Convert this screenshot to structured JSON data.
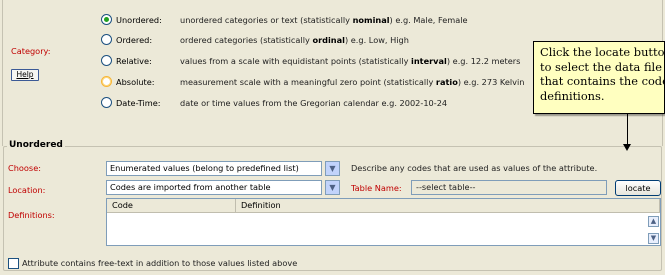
{
  "category": {
    "label": "Category:",
    "help_label": "Help",
    "options": [
      {
        "label": "Unordered:",
        "desc_pre": "unordered categories or text (statistically ",
        "desc_bold": "nominal",
        "desc_post": ") e.g. Male, Female",
        "selected": true
      },
      {
        "label": "Ordered:",
        "desc_pre": "ordered categories (statistically ",
        "desc_bold": "ordinal",
        "desc_post": ") e.g. Low, High",
        "selected": false
      },
      {
        "label": "Relative:",
        "desc_pre": "values from a scale with equidistant points (statistically ",
        "desc_bold": "interval",
        "desc_post": ") e.g. 12.2 meters",
        "selected": false
      },
      {
        "label": "Absolute:",
        "desc_pre": "measurement scale with a meaningful zero point (statistically ",
        "desc_bold": "ratio",
        "desc_post": ") e.g. 273 Kelvin",
        "selected": false
      },
      {
        "label": "Date-Time:",
        "desc_pre": "date or time values from the Gregorian calendar e.g. 2002-10-24",
        "desc_bold": "",
        "desc_post": "",
        "selected": false
      }
    ]
  },
  "unordered": {
    "group_title": "Unordered",
    "choose_label": "Choose:",
    "choose_value": "Enumerated values (belong to predefined list)",
    "choose_hint": "Describe any codes that are used as values of the attribute.",
    "location_label": "Location:",
    "location_value": "Codes are imported from another table",
    "table_name_label": "Table Name:",
    "table_name_value": "--select table--",
    "locate_button": "locate",
    "definitions_label": "Definitions:",
    "columns": [
      "Code",
      "Definition"
    ],
    "freetext_label": "Attribute contains free-text in addition to those values listed above"
  },
  "callout": {
    "lines": [
      "Click the locate button",
      "to select the data file",
      "that contains the code",
      "definitions."
    ]
  },
  "colors": {
    "label_red": "#c00000",
    "callout_bg": "#ffffc0",
    "panel_bg": "#ece9d8"
  },
  "icons": {
    "dropdown": "chevron-down-icon",
    "scroll_up": "arrow-up-icon",
    "scroll_down": "arrow-down-icon"
  }
}
